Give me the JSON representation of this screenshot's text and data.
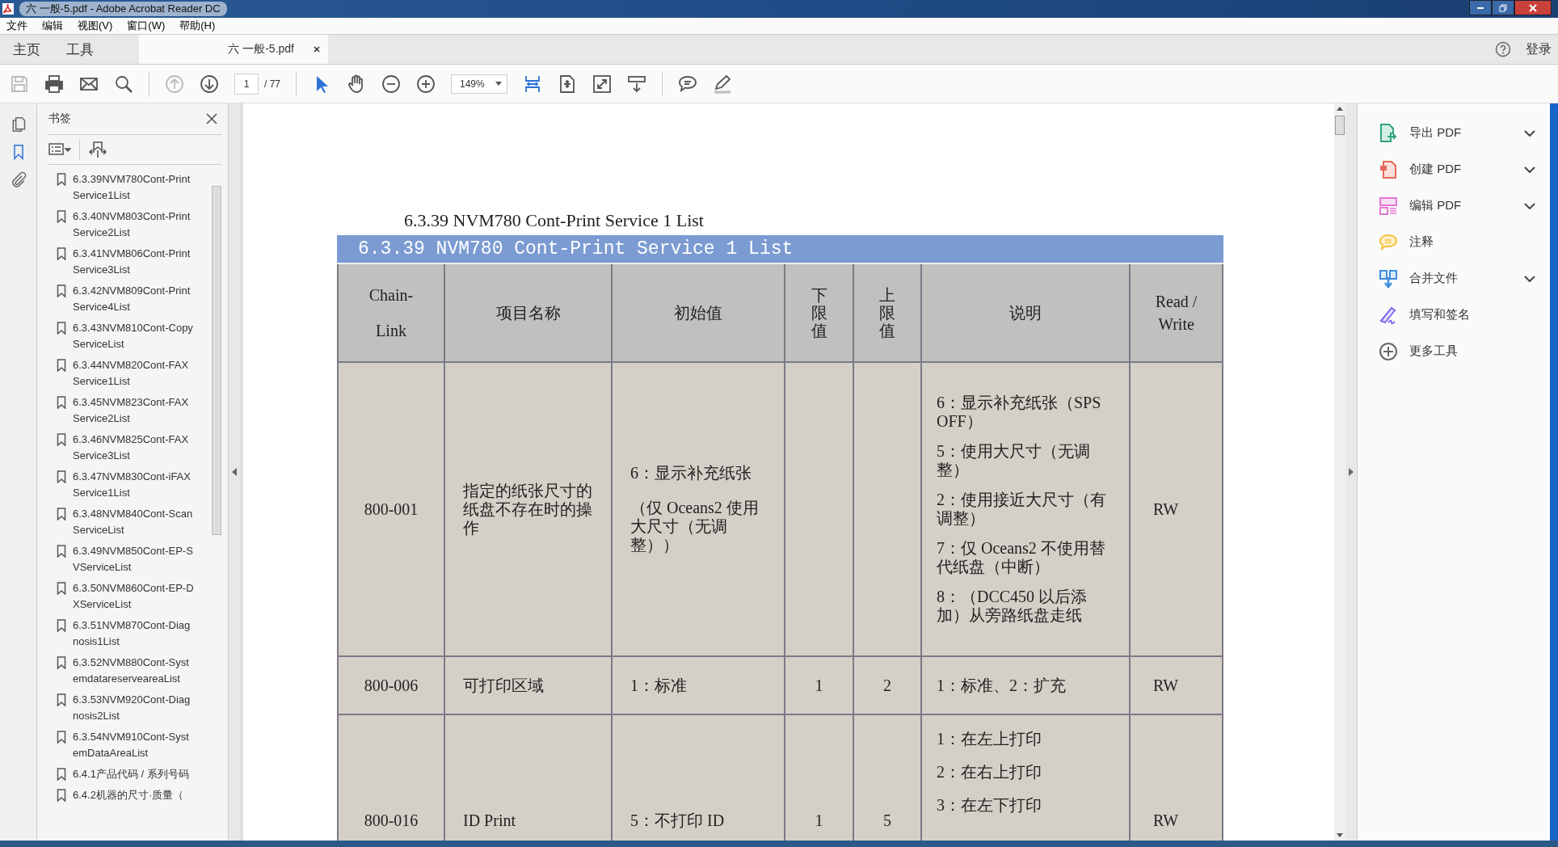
{
  "window": {
    "title": "六  一般-5.pdf - Adobe Acrobat Reader DC"
  },
  "menu": [
    "文件",
    "编辑",
    "视图(V)",
    "窗口(W)",
    "帮助(H)"
  ],
  "tabs": [
    {
      "label": "主页",
      "selected": false,
      "closable": false
    },
    {
      "label": "工具",
      "selected": false,
      "closable": false
    },
    {
      "label": "六  一般-5.pdf",
      "selected": true,
      "closable": true
    }
  ],
  "account": {
    "label": "登录"
  },
  "toolbar": [
    {
      "kind": "save",
      "disabled": true,
      "selected": false
    },
    {
      "kind": "print",
      "disabled": false,
      "selected": false
    },
    {
      "kind": "mail",
      "disabled": false,
      "selected": false
    },
    {
      "kind": "search",
      "disabled": false,
      "selected": false
    },
    {
      "kind": "divider"
    },
    {
      "kind": "up",
      "disabled": true,
      "selected": false
    },
    {
      "kind": "down",
      "disabled": false,
      "selected": false
    },
    {
      "kind": "page",
      "value": "1",
      "total": "/ 77"
    },
    {
      "kind": "divider"
    },
    {
      "kind": "select",
      "disabled": false,
      "selected": true
    },
    {
      "kind": "hand",
      "disabled": false,
      "selected": false
    },
    {
      "kind": "zoomout",
      "disabled": false,
      "selected": false
    },
    {
      "kind": "zoomin",
      "disabled": false,
      "selected": false
    },
    {
      "kind": "zoom",
      "value": "149%"
    },
    {
      "kind": "fitwidth",
      "disabled": false,
      "selected": true
    },
    {
      "kind": "fitpage",
      "disabled": false,
      "selected": false
    },
    {
      "kind": "fullscreen",
      "disabled": false,
      "selected": false
    },
    {
      "kind": "scroll",
      "disabled": false,
      "selected": false
    },
    {
      "kind": "divider"
    },
    {
      "kind": "comment",
      "disabled": false,
      "selected": false
    },
    {
      "kind": "pen",
      "disabled": false,
      "selected": false
    }
  ],
  "rail": [
    {
      "kind": "pages",
      "selected": false
    },
    {
      "kind": "bookmarks",
      "selected": true
    },
    {
      "kind": "attachments",
      "selected": false
    }
  ],
  "bookmarks": {
    "title": "书签",
    "items": [
      "6.3.39NVM780Cont-PrintService1List",
      "6.3.40NVM803Cont-PrintService2List",
      "6.3.41NVM806Cont-PrintService3List",
      "6.3.42NVM809Cont-PrintService4List",
      "6.3.43NVM810Cont-CopyServiceList",
      "6.3.44NVM820Cont-FAXService1List",
      "6.3.45NVM823Cont-FAXService2List",
      "6.3.46NVM825Cont-FAXService3List",
      "6.3.47NVM830Cont-iFAXService1List",
      "6.3.48NVM840Cont-ScanServiceList",
      "6.3.49NVM850Cont-EP-SVServiceList",
      "6.3.50NVM860Cont-EP-DXServiceList",
      "6.3.51NVM870Cont-Diagnosis1List",
      "6.3.52NVM880Cont-SystemdatareserveareaList",
      "6.3.53NVM920Cont-Diagnosis2List",
      "6.3.54NVM910Cont-SystemDataAreaList",
      "6.4.1产品代码 / 系列号码",
      "6.4.2机器的尺寸·质量（"
    ]
  },
  "document": {
    "heading": "6.3.39 NVM780 Cont-Print Service 1 List",
    "table": {
      "caption": "6.3.39 NVM780 Cont-Print Service 1 List",
      "columns": [
        "Chain-Link",
        "项目名称",
        "初始值",
        "下限值",
        "上限值",
        "说明",
        "Read / Write"
      ],
      "rows": [
        {
          "chain_link": "800-001",
          "item": "指定的纸张尺寸的纸盘不存在时的操作",
          "initial": [
            "6：显示补充纸张",
            "（仅 Oceans2 使用大尺寸（无调整））"
          ],
          "description": [
            "6：显示补充纸张（SPS OFF）",
            "5：使用大尺寸（无调整）",
            "2：使用接近大尺寸（有调整）",
            "7：仅 Oceans2 不使用替代纸盘（中断）",
            "8：（DCC450 以后添加）从旁路纸盘走纸"
          ],
          "rw": "RW"
        },
        {
          "chain_link": "800-006",
          "item": "可打印区域",
          "initial": [
            "1：标准"
          ],
          "lower": "1",
          "upper": "2",
          "description": [
            "1：标准、2：扩充"
          ],
          "rw": "RW"
        },
        {
          "chain_link": "800-016",
          "item": "ID Print",
          "initial": [
            "5：不打印 ID"
          ],
          "lower": "1",
          "upper": "5",
          "description": [
            "1：在左上打印",
            "2：在右上打印",
            "3：在左下打印"
          ],
          "rw": "RW"
        }
      ]
    }
  },
  "tools": [
    {
      "kind": "export",
      "label": "导出 PDF",
      "has_menu": true
    },
    {
      "kind": "create",
      "label": "创建 PDF",
      "has_menu": true
    },
    {
      "kind": "edit",
      "label": "编辑 PDF",
      "has_menu": true
    },
    {
      "kind": "comment",
      "label": "注释",
      "has_menu": false
    },
    {
      "kind": "combine",
      "label": "合并文件",
      "has_menu": true
    },
    {
      "kind": "sign",
      "label": "填写和签名",
      "has_menu": false
    },
    {
      "kind": "more",
      "label": "更多工具",
      "has_menu": false
    }
  ]
}
